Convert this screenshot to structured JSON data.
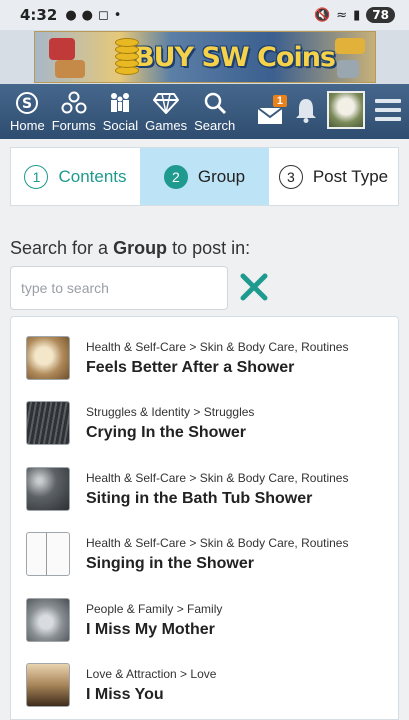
{
  "status_bar": {
    "time": "4:32",
    "battery": "78"
  },
  "banner": {
    "text": "BUY SW Coins"
  },
  "nav": {
    "items": [
      {
        "label": "Home",
        "icon": "home-s-icon"
      },
      {
        "label": "Forums",
        "icon": "forums-icon"
      },
      {
        "label": "Social",
        "icon": "social-icon"
      },
      {
        "label": "Games",
        "icon": "diamond-icon"
      },
      {
        "label": "Search",
        "icon": "search-icon"
      }
    ],
    "mail_badge": "1"
  },
  "steps": [
    {
      "num": "1",
      "label": "Contents"
    },
    {
      "num": "2",
      "label": "Group"
    },
    {
      "num": "3",
      "label": "Post Type"
    }
  ],
  "search": {
    "prompt_prefix": "Search for a ",
    "prompt_bold": "Group",
    "prompt_suffix": " to post in:",
    "placeholder": "type to search",
    "value": ""
  },
  "results": [
    {
      "category": "Health & Self-Care > Skin & Body Care, Routines",
      "title": "Feels Better After a Shower",
      "thumb": "#b08a5a"
    },
    {
      "category": "Struggles & Identity > Struggles",
      "title": "Crying In the Shower",
      "thumb": "#3f4245"
    },
    {
      "category": "Health & Self-Care > Skin & Body Care, Routines",
      "title": "Siting in the Bath Tub Shower",
      "thumb": "#5d6266"
    },
    {
      "category": "Health & Self-Care > Skin & Body Care, Routines",
      "title": "Singing in the Shower",
      "thumb": "#f4f4f4"
    },
    {
      "category": "People & Family > Family",
      "title": "I Miss My Mother",
      "thumb": "#8a9094"
    },
    {
      "category": "Love & Attraction > Love",
      "title": "I Miss You",
      "thumb": "#a8855a"
    }
  ],
  "colors": {
    "accent": "#1e9a8e",
    "nav_bg": "#3a5a7d",
    "active_step": "#bde3f7",
    "badge": "#e9821a"
  }
}
